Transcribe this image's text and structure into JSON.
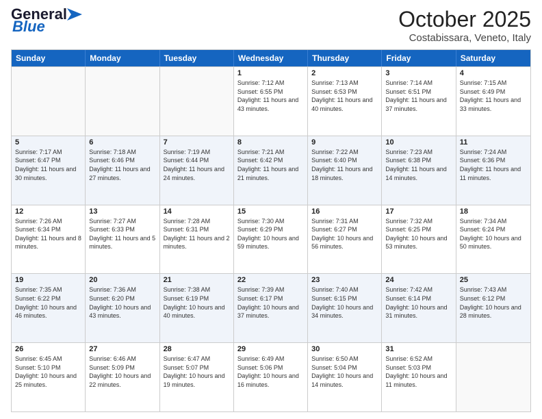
{
  "logo": {
    "line1": "General",
    "line2": "Blue"
  },
  "title": "October 2025",
  "location": "Costabissara, Veneto, Italy",
  "days_of_week": [
    "Sunday",
    "Monday",
    "Tuesday",
    "Wednesday",
    "Thursday",
    "Friday",
    "Saturday"
  ],
  "rows": [
    [
      {
        "day": "",
        "info": ""
      },
      {
        "day": "",
        "info": ""
      },
      {
        "day": "",
        "info": ""
      },
      {
        "day": "1",
        "info": "Sunrise: 7:12 AM\nSunset: 6:55 PM\nDaylight: 11 hours and 43 minutes."
      },
      {
        "day": "2",
        "info": "Sunrise: 7:13 AM\nSunset: 6:53 PM\nDaylight: 11 hours and 40 minutes."
      },
      {
        "day": "3",
        "info": "Sunrise: 7:14 AM\nSunset: 6:51 PM\nDaylight: 11 hours and 37 minutes."
      },
      {
        "day": "4",
        "info": "Sunrise: 7:15 AM\nSunset: 6:49 PM\nDaylight: 11 hours and 33 minutes."
      }
    ],
    [
      {
        "day": "5",
        "info": "Sunrise: 7:17 AM\nSunset: 6:47 PM\nDaylight: 11 hours and 30 minutes."
      },
      {
        "day": "6",
        "info": "Sunrise: 7:18 AM\nSunset: 6:46 PM\nDaylight: 11 hours and 27 minutes."
      },
      {
        "day": "7",
        "info": "Sunrise: 7:19 AM\nSunset: 6:44 PM\nDaylight: 11 hours and 24 minutes."
      },
      {
        "day": "8",
        "info": "Sunrise: 7:21 AM\nSunset: 6:42 PM\nDaylight: 11 hours and 21 minutes."
      },
      {
        "day": "9",
        "info": "Sunrise: 7:22 AM\nSunset: 6:40 PM\nDaylight: 11 hours and 18 minutes."
      },
      {
        "day": "10",
        "info": "Sunrise: 7:23 AM\nSunset: 6:38 PM\nDaylight: 11 hours and 14 minutes."
      },
      {
        "day": "11",
        "info": "Sunrise: 7:24 AM\nSunset: 6:36 PM\nDaylight: 11 hours and 11 minutes."
      }
    ],
    [
      {
        "day": "12",
        "info": "Sunrise: 7:26 AM\nSunset: 6:34 PM\nDaylight: 11 hours and 8 minutes."
      },
      {
        "day": "13",
        "info": "Sunrise: 7:27 AM\nSunset: 6:33 PM\nDaylight: 11 hours and 5 minutes."
      },
      {
        "day": "14",
        "info": "Sunrise: 7:28 AM\nSunset: 6:31 PM\nDaylight: 11 hours and 2 minutes."
      },
      {
        "day": "15",
        "info": "Sunrise: 7:30 AM\nSunset: 6:29 PM\nDaylight: 10 hours and 59 minutes."
      },
      {
        "day": "16",
        "info": "Sunrise: 7:31 AM\nSunset: 6:27 PM\nDaylight: 10 hours and 56 minutes."
      },
      {
        "day": "17",
        "info": "Sunrise: 7:32 AM\nSunset: 6:25 PM\nDaylight: 10 hours and 53 minutes."
      },
      {
        "day": "18",
        "info": "Sunrise: 7:34 AM\nSunset: 6:24 PM\nDaylight: 10 hours and 50 minutes."
      }
    ],
    [
      {
        "day": "19",
        "info": "Sunrise: 7:35 AM\nSunset: 6:22 PM\nDaylight: 10 hours and 46 minutes."
      },
      {
        "day": "20",
        "info": "Sunrise: 7:36 AM\nSunset: 6:20 PM\nDaylight: 10 hours and 43 minutes."
      },
      {
        "day": "21",
        "info": "Sunrise: 7:38 AM\nSunset: 6:19 PM\nDaylight: 10 hours and 40 minutes."
      },
      {
        "day": "22",
        "info": "Sunrise: 7:39 AM\nSunset: 6:17 PM\nDaylight: 10 hours and 37 minutes."
      },
      {
        "day": "23",
        "info": "Sunrise: 7:40 AM\nSunset: 6:15 PM\nDaylight: 10 hours and 34 minutes."
      },
      {
        "day": "24",
        "info": "Sunrise: 7:42 AM\nSunset: 6:14 PM\nDaylight: 10 hours and 31 minutes."
      },
      {
        "day": "25",
        "info": "Sunrise: 7:43 AM\nSunset: 6:12 PM\nDaylight: 10 hours and 28 minutes."
      }
    ],
    [
      {
        "day": "26",
        "info": "Sunrise: 6:45 AM\nSunset: 5:10 PM\nDaylight: 10 hours and 25 minutes."
      },
      {
        "day": "27",
        "info": "Sunrise: 6:46 AM\nSunset: 5:09 PM\nDaylight: 10 hours and 22 minutes."
      },
      {
        "day": "28",
        "info": "Sunrise: 6:47 AM\nSunset: 5:07 PM\nDaylight: 10 hours and 19 minutes."
      },
      {
        "day": "29",
        "info": "Sunrise: 6:49 AM\nSunset: 5:06 PM\nDaylight: 10 hours and 16 minutes."
      },
      {
        "day": "30",
        "info": "Sunrise: 6:50 AM\nSunset: 5:04 PM\nDaylight: 10 hours and 14 minutes."
      },
      {
        "day": "31",
        "info": "Sunrise: 6:52 AM\nSunset: 5:03 PM\nDaylight: 10 hours and 11 minutes."
      },
      {
        "day": "",
        "info": ""
      }
    ]
  ]
}
